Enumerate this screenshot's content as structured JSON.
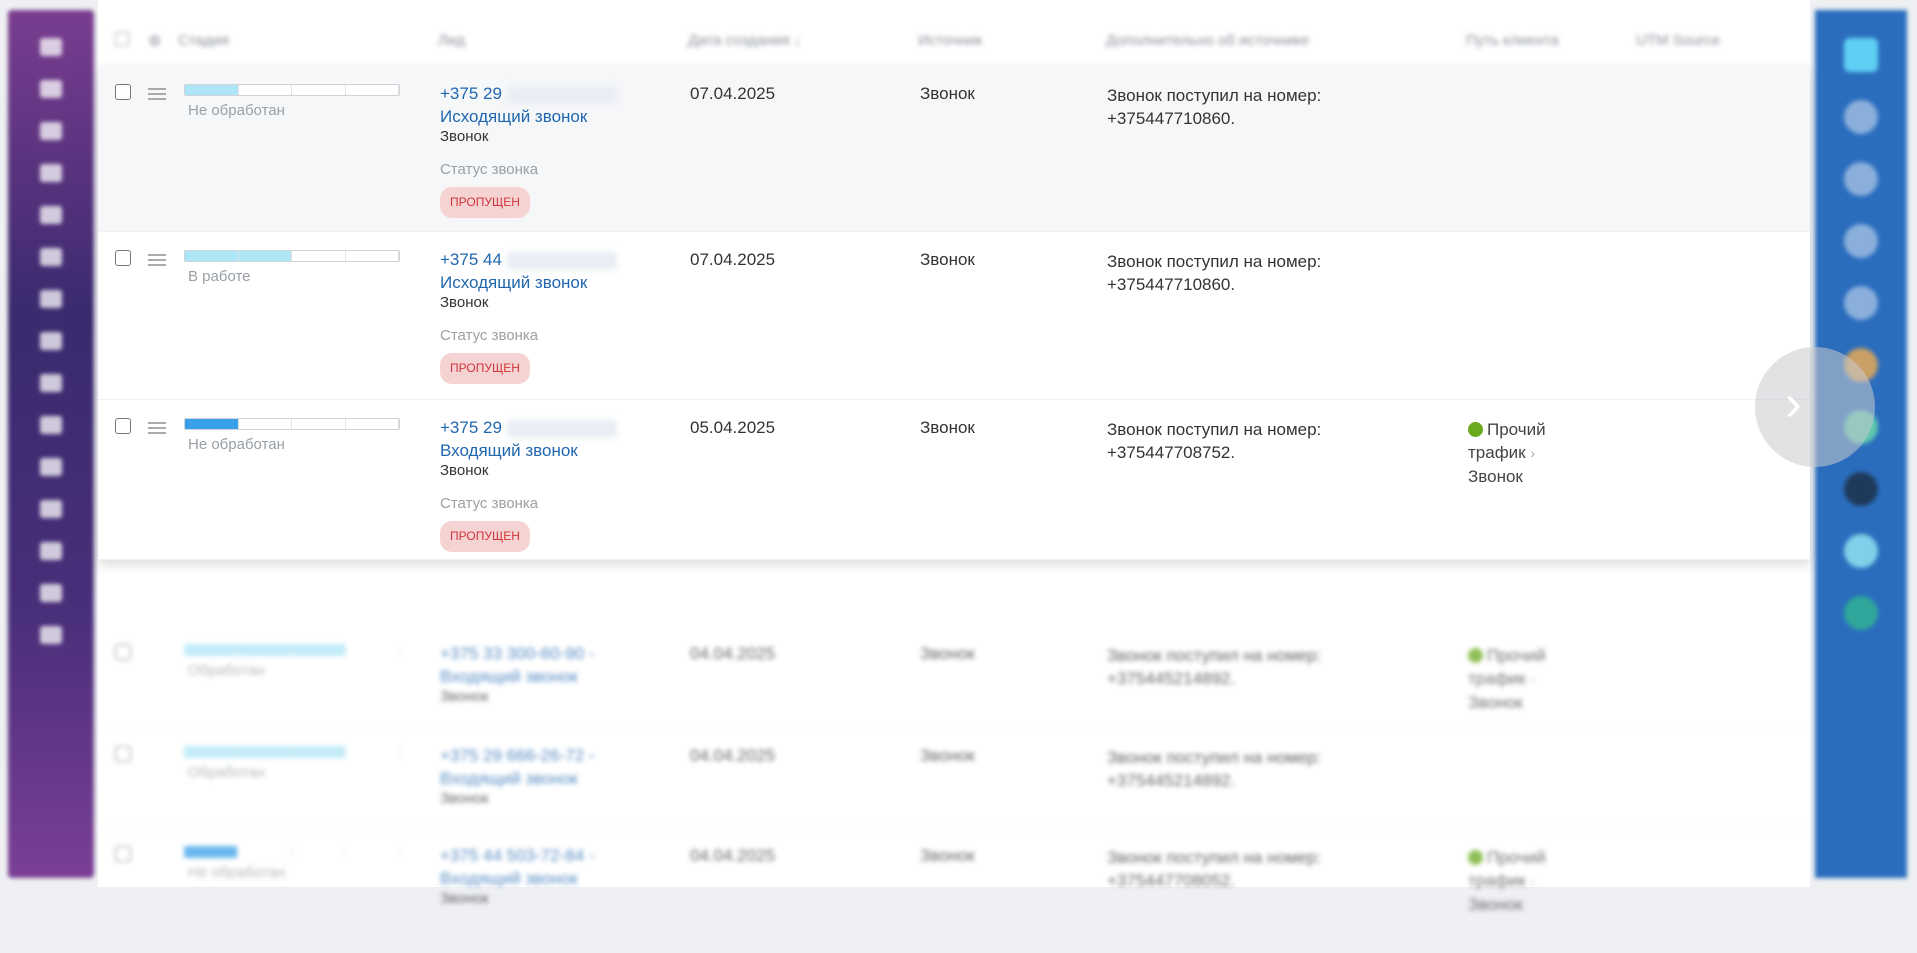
{
  "header": {
    "columns": [
      "Стадия",
      "Лид",
      "Дата создания ↓",
      "Источник",
      "Дополнительно об источнике",
      "Путь клиента",
      "UTM Source"
    ]
  },
  "rows": [
    {
      "stage": "Не обработан",
      "stage_fill": 1,
      "phone": "+375 29",
      "lead": "Исходящий звонок",
      "type": "Звонок",
      "status_label": "Статус звонка",
      "status": "ПРОПУЩЕН",
      "date": "07.04.2025",
      "source": "Звонок",
      "extra1": "Звонок поступил на номер:",
      "extra2": "+375447710860."
    },
    {
      "stage": "В работе",
      "stage_fill": 2,
      "phone": "+375 44",
      "lead": "Исходящий звонок",
      "type": "Звонок",
      "status_label": "Статус звонка",
      "status": "ПРОПУЩЕН",
      "date": "07.04.2025",
      "source": "Звонок",
      "extra1": "Звонок поступил на номер:",
      "extra2": "+375447710860."
    },
    {
      "stage": "Не обработан",
      "stage_fill": 1,
      "phone": "+375 29",
      "lead": "Входящий звонок",
      "type": "Звонок",
      "status_label": "Статус звонка",
      "status": "ПРОПУЩЕН",
      "date": "05.04.2025",
      "source": "Звонок",
      "extra1": "Звонок поступил на номер:",
      "extra2": "+375447708752.",
      "path1": "Прочий",
      "path2": "трафик",
      "path3": "Звонок"
    }
  ],
  "blurred_rows": [
    {
      "stage": "Обработан",
      "phone": "+375 33 300-60-90 -",
      "lead": "Входящий звонок",
      "type": "Звонок",
      "date": "04.04.2025",
      "source": "Звонок",
      "extra1": "Звонок поступил на номер:",
      "extra2": "+375445214892.",
      "path1": "Прочий",
      "path2": "трафик",
      "path3": "Звонок"
    },
    {
      "stage": "Обработан",
      "phone": "+375 29 666-26-72 -",
      "lead": "Входящий звонок",
      "type": "Звонок",
      "date": "04.04.2025",
      "source": "Звонок",
      "extra1": "Звонок поступил на номер:",
      "extra2": "+375445214892."
    },
    {
      "stage": "Не обработан",
      "phone": "+375 44 503-72-84 -",
      "lead": "Входящий звонок",
      "type": "Звонок",
      "date": "04.04.2025",
      "source": "Звонок",
      "extra1": "Звонок поступил на номер:",
      "extra2": "+375447708052.",
      "path1": "Прочий",
      "path2": "трафик",
      "path3": "Звонок"
    }
  ],
  "colors": {
    "accent": "#2067b0",
    "badge_bg": "#f5d3d3",
    "badge_text": "#d2343c",
    "right_sidebar": "#2a6dbd"
  }
}
